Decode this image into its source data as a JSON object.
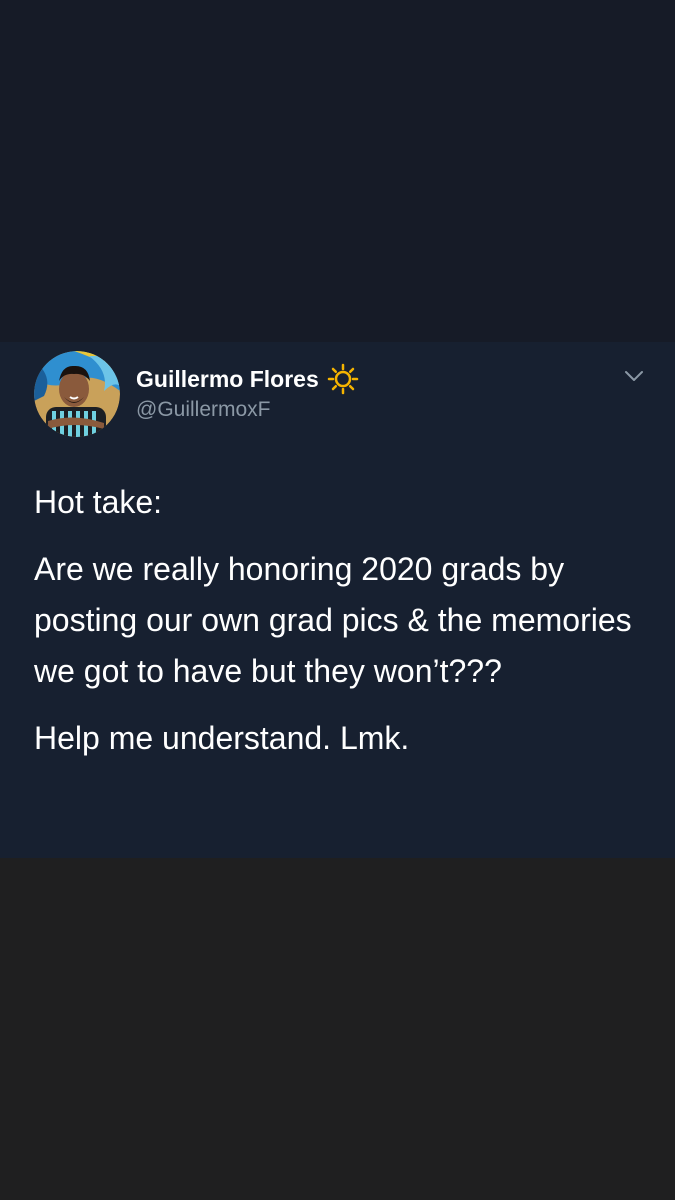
{
  "tweet": {
    "display_name": "Guillermo Flores",
    "handle": "@GuillermoxF",
    "paragraphs": [
      "Hot take:",
      "Are we really honoring 2020 grads by posting our own grad pics & the memories we got to have but they won’t???",
      "Help me understand. Lmk."
    ],
    "name_emoji": "sun-icon",
    "menu_icon": "chevron-down-icon"
  },
  "colors": {
    "card_background": "#172030",
    "top_background": "#161b27",
    "bottom_background": "#1f1f20",
    "text_primary": "#ffffff",
    "text_secondary": "#8b98a5",
    "sun_color": "#f5b400"
  }
}
